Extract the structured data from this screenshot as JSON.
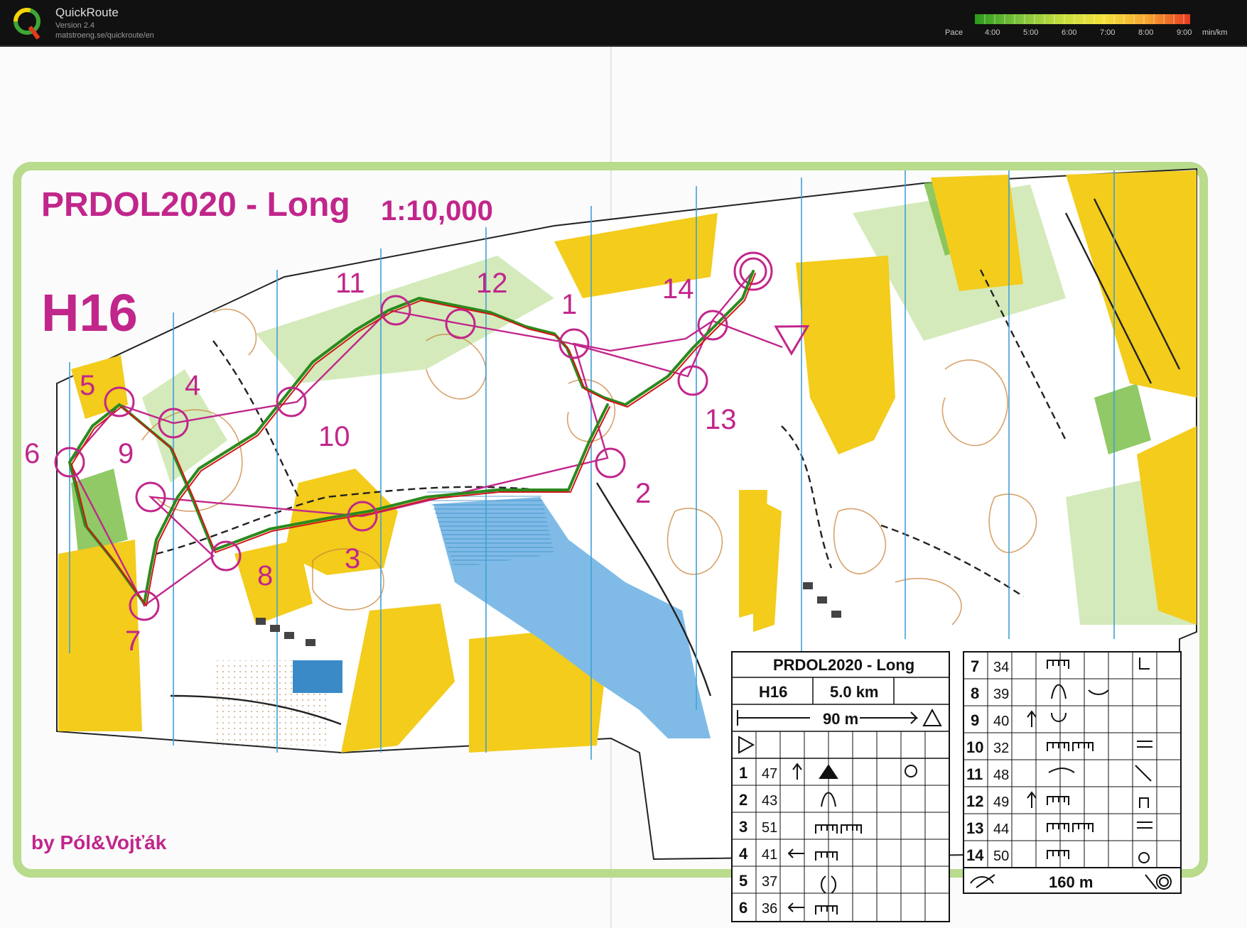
{
  "app": {
    "name": "QuickRoute",
    "version": "Version 2.4",
    "url": "matstroeng.se/quickroute/en"
  },
  "pace_legend": {
    "label": "Pace",
    "ticks": [
      "4:00",
      "5:00",
      "6:00",
      "7:00",
      "8:00",
      "9:00"
    ],
    "unit": "min/km",
    "colors": [
      "#2a9a1c",
      "#7cc23a",
      "#c6dd3c",
      "#f5e23a",
      "#f7a530",
      "#e5391f"
    ]
  },
  "map": {
    "title": "PRDOL2020 - Long",
    "scale": "1:10,000",
    "category": "H16",
    "credit": "by Pól&Vojťák",
    "controls": [
      "1",
      "2",
      "3",
      "4",
      "5",
      "6",
      "7",
      "8",
      "9",
      "10",
      "11",
      "12",
      "13",
      "14"
    ]
  },
  "description_sheet": {
    "title": "PRDOL2020 - Long",
    "category": "H16",
    "length": "5.0 km",
    "start_leg": "90 m",
    "finish_leg": "160 m",
    "rows": [
      {
        "no": "1",
        "code": "47"
      },
      {
        "no": "2",
        "code": "43"
      },
      {
        "no": "3",
        "code": "51"
      },
      {
        "no": "4",
        "code": "41"
      },
      {
        "no": "5",
        "code": "37"
      },
      {
        "no": "6",
        "code": "36"
      },
      {
        "no": "7",
        "code": "34"
      },
      {
        "no": "8",
        "code": "39"
      },
      {
        "no": "9",
        "code": "40"
      },
      {
        "no": "10",
        "code": "32"
      },
      {
        "no": "11",
        "code": "48"
      },
      {
        "no": "12",
        "code": "49"
      },
      {
        "no": "13",
        "code": "44"
      },
      {
        "no": "14",
        "code": "50"
      }
    ]
  },
  "colors": {
    "course": "#c1268b",
    "route_red": "#d01818",
    "route_green": "#2a8a1c",
    "yellow": "#f3cc1c",
    "green": "#7cc04a",
    "water": "#7fbbe6",
    "border": "#b8db8c"
  }
}
